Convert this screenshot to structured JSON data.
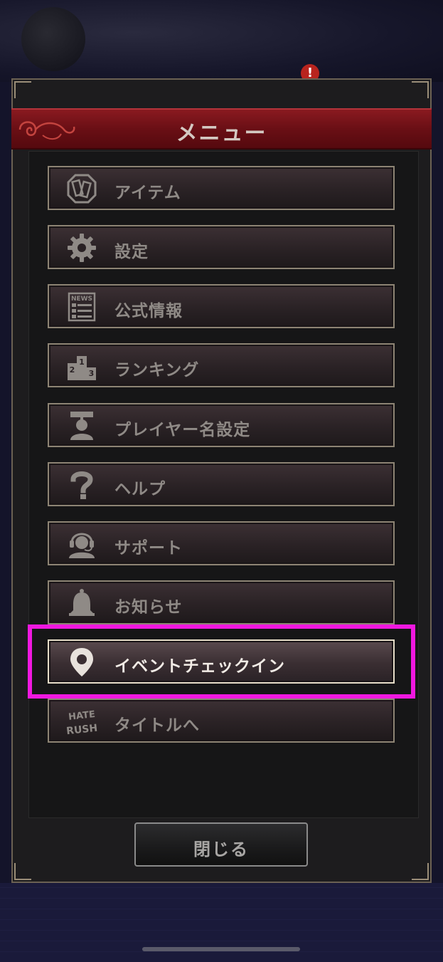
{
  "background": {
    "notification_badge": "!"
  },
  "menu": {
    "title": "メニュー",
    "items": [
      {
        "label": "アイテム",
        "icon": "item-icon"
      },
      {
        "label": "設定",
        "icon": "gear-icon"
      },
      {
        "label": "公式情報",
        "icon": "news-icon",
        "icon_text": "NEWS"
      },
      {
        "label": "ランキング",
        "icon": "podium-icon",
        "icon_text": [
          "1",
          "2",
          "3"
        ]
      },
      {
        "label": "プレイヤー名設定",
        "icon": "player-icon"
      },
      {
        "label": "ヘルプ",
        "icon": "question-icon"
      },
      {
        "label": "サポート",
        "icon": "headset-icon"
      },
      {
        "label": "お知らせ",
        "icon": "bell-icon"
      },
      {
        "label": "イベントチェックイン",
        "icon": "location-pin-icon",
        "selected": true
      },
      {
        "label": "タイトルへ",
        "icon": "game-logo-icon",
        "icon_text": [
          "HATE",
          "RUSH"
        ]
      }
    ],
    "close_label": "閉じる"
  },
  "colors": {
    "title_bar": "#6a0f15",
    "highlight": "#f018e0",
    "label_inactive": "#8f8a86",
    "label_active": "#f2ece6"
  }
}
